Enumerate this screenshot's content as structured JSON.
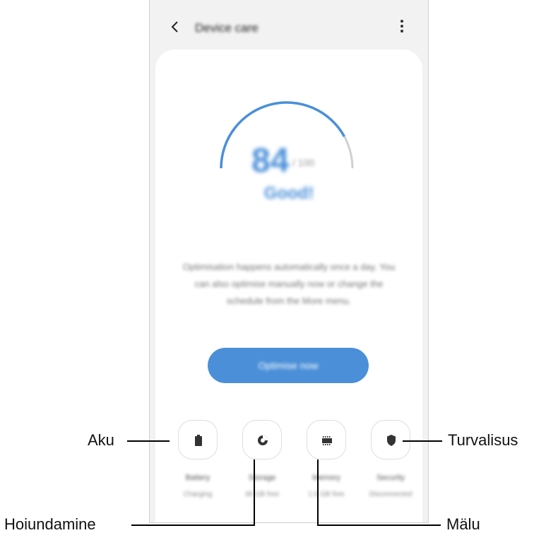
{
  "app": {
    "title": "Device care",
    "back_icon": "chevron-left-icon",
    "more_icon": "more-vertical-icon"
  },
  "score": {
    "value": "84",
    "max": "/ 100",
    "level": 0.84,
    "status": "Good!"
  },
  "message": "Optimisation happens automatically once a day. You can also optimise manually now or change the schedule from the More menu.",
  "optimize_button": "Optimise now",
  "tiles": [
    {
      "label": "Battery",
      "sub": "Charging",
      "icon": "battery-icon"
    },
    {
      "label": "Storage",
      "sub": "48 GB free",
      "icon": "storage-pie-icon"
    },
    {
      "label": "Memory",
      "sub": "1.5 GB free",
      "icon": "memory-chip-icon"
    },
    {
      "label": "Security",
      "sub": "Disconnected",
      "icon": "shield-icon"
    }
  ],
  "callouts": {
    "battery": "Aku",
    "storage": "Hoiundamine",
    "memory": "Mälu",
    "security": "Turvalisus"
  },
  "colors": {
    "accent": "#4a8fd8",
    "gauge_track": "#d0d0d0",
    "callout_line": "#000000"
  }
}
